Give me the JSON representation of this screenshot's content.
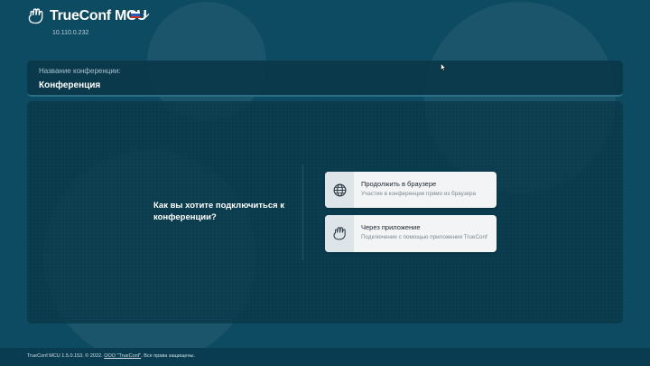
{
  "header": {
    "logo_text": "TrueConf MCU",
    "language": {
      "icon": "flag-ru-icon",
      "chevron": "chevron-down-icon"
    },
    "server_ip": "10.110.0.232"
  },
  "conference": {
    "label": "Название конференции:",
    "name": "Конференция"
  },
  "join": {
    "question": "Как вы хотите подключиться к конференции?",
    "options": [
      {
        "icon": "globe-icon",
        "title": "Продолжить в браузере",
        "description": "Участие в конференции прямо из браузера"
      },
      {
        "icon": "trueconf-app-icon",
        "title": "Через приложение",
        "description": "Подключение с помощью приложения TrueConf"
      }
    ]
  },
  "footer": {
    "prefix": "TrueConf MCU 1.5.0.153. © 2022.",
    "company_link": "ООО \"TrueConf\"",
    "suffix": ". Все права защищены."
  },
  "colors": {
    "background": "#0c4b62",
    "panel": "#093748",
    "card": "#f3f4f5",
    "icon_tile": "#dde5e8",
    "footer": "#093c50"
  }
}
